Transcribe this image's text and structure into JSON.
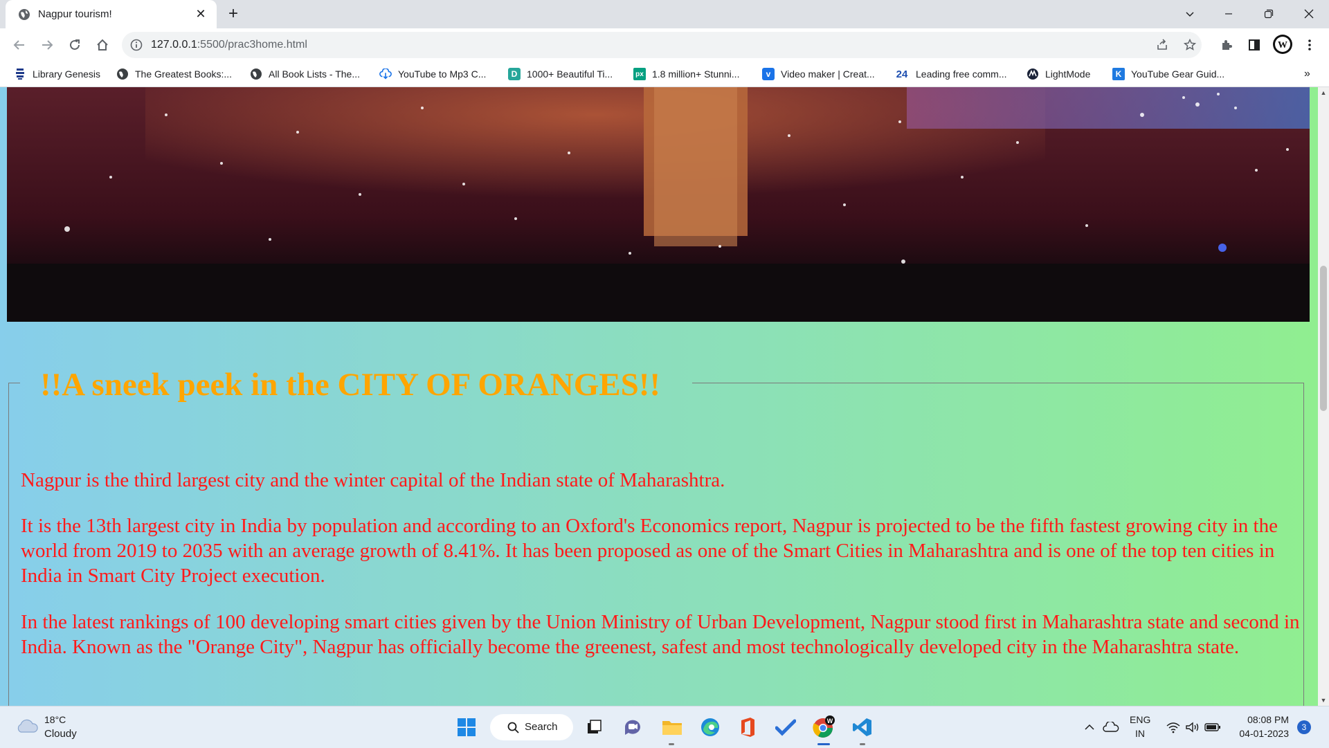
{
  "browser": {
    "tab_title": "Nagpur tourism!",
    "url_host": "127.0.0.1",
    "url_path": ":5500/prac3home.html"
  },
  "bookmarks": [
    {
      "label": "Library Genesis",
      "icon": "library-genesis-icon"
    },
    {
      "label": "The Greatest Books:...",
      "icon": "globe-icon"
    },
    {
      "label": "All Book Lists - The...",
      "icon": "globe-icon"
    },
    {
      "label": "YouTube to Mp3 C...",
      "icon": "download-cloud-icon"
    },
    {
      "label": "1000+ Beautiful Ti...",
      "icon": "d-logo-icon"
    },
    {
      "label": "1.8 million+ Stunni...",
      "icon": "px-logo-icon"
    },
    {
      "label": "Video maker | Creat...",
      "icon": "v-logo-icon"
    },
    {
      "label": "Leading free comm...",
      "icon": "24-logo-icon"
    },
    {
      "label": "LightMode",
      "icon": "lightmode-icon"
    },
    {
      "label": "YouTube Gear Guid...",
      "icon": "k-logo-icon"
    }
  ],
  "page": {
    "legend": "!!A sneek peek in the CITY OF ORANGES!!",
    "paragraphs": [
      "Nagpur is the third largest city and the winter capital of the Indian state of Maharashtra.",
      "It is the 13th largest city in India by population and according to an Oxford's Economics report, Nagpur is projected to be the fifth fastest growing city in the world from 2019 to 2035 with an average growth of 8.41%. It has been proposed as one of the Smart Cities in Maharashtra and is one of the top ten cities in India in Smart City Project execution.",
      "In the latest rankings of 100 developing smart cities given by the Union Ministry of Urban Development, Nagpur stood first in Maharashtra state and second in India. Known as the \"Orange City\", Nagpur has officially become the greenest, safest and most technologically developed city in the Maharashtra state."
    ],
    "colors": {
      "heading": "#ffa500",
      "text": "#ff1a1a",
      "gradient_start": "#87ceeb",
      "gradient_end": "#90ee90"
    }
  },
  "taskbar": {
    "weather_temp": "18°C",
    "weather_desc": "Cloudy",
    "search_label": "Search",
    "lang_top": "ENG",
    "lang_bottom": "IN",
    "time": "08:08 PM",
    "date": "04-01-2023",
    "notification_count": "3"
  }
}
